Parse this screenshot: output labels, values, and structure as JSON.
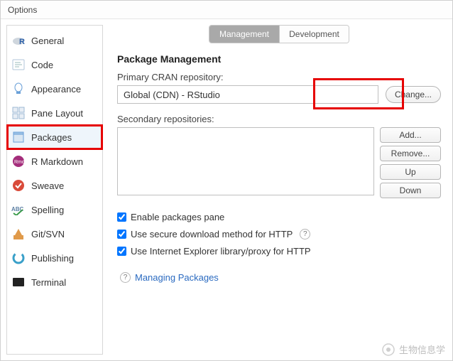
{
  "window": {
    "title": "Options"
  },
  "sidebar": {
    "items": [
      {
        "label": "General"
      },
      {
        "label": "Code"
      },
      {
        "label": "Appearance"
      },
      {
        "label": "Pane Layout"
      },
      {
        "label": "Packages"
      },
      {
        "label": "R Markdown"
      },
      {
        "label": "Sweave"
      },
      {
        "label": "Spelling"
      },
      {
        "label": "Git/SVN"
      },
      {
        "label": "Publishing"
      },
      {
        "label": "Terminal"
      }
    ],
    "selected_index": 4
  },
  "tabs": {
    "items": [
      {
        "label": "Management"
      },
      {
        "label": "Development"
      }
    ],
    "active_index": 0
  },
  "section": {
    "heading": "Package Management",
    "primary_label": "Primary CRAN repository:",
    "primary_value": "Global (CDN) - RStudio",
    "change_button": "Change...",
    "secondary_label": "Secondary repositories:",
    "buttons": {
      "add": "Add...",
      "remove": "Remove...",
      "up": "Up",
      "down": "Down"
    },
    "checks": {
      "enable_pane": "Enable packages pane",
      "secure_http": "Use secure download method for HTTP",
      "ie_proxy": "Use Internet Explorer library/proxy for HTTP"
    },
    "help_link": "Managing Packages"
  },
  "watermark": "生物信息学"
}
